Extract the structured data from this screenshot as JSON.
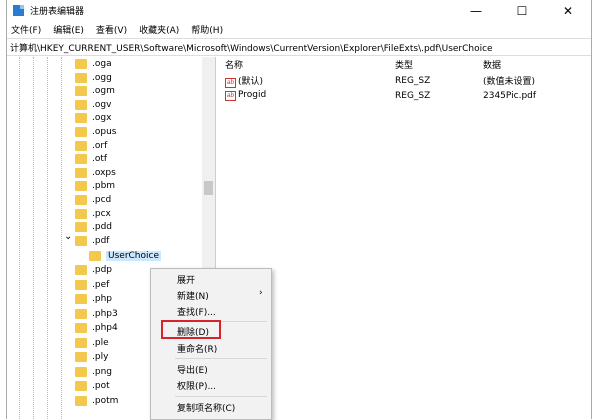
{
  "window": {
    "title": "注册表编辑器",
    "min": "—",
    "max": "☐",
    "close": "✕"
  },
  "menu": [
    "文件(F)",
    "编辑(E)",
    "查看(V)",
    "收藏夹(A)",
    "帮助(H)"
  ],
  "address": "计算机\\HKEY_CURRENT_USER\\Software\\Microsoft\\Windows\\CurrentVersion\\Explorer\\FileExts\\.pdf\\UserChoice",
  "tree": {
    "before": [
      ".oga",
      ".ogg",
      ".ogm",
      ".ogv",
      ".ogx",
      ".opus",
      ".orf",
      ".otf",
      ".oxps",
      ".pbm",
      ".pcd",
      ".pcx",
      ".pdd",
      ".pdf"
    ],
    "selected": "UserChoice",
    "after": [
      ".pdp",
      ".pef",
      ".php",
      ".php3",
      ".php4",
      ".ple",
      ".ply",
      ".png",
      ".pot",
      ".potm"
    ]
  },
  "values": {
    "headers": [
      "名称",
      "类型",
      "数据"
    ],
    "rows": [
      {
        "name": "(默认)",
        "type": "REG_SZ",
        "data": "(数值未设置)"
      },
      {
        "name": "Progid",
        "type": "REG_SZ",
        "data": "2345Pic.pdf"
      }
    ]
  },
  "context_menu": {
    "expand": "展开",
    "new": "新建(N)",
    "arrow": "›",
    "find": "查找(F)...",
    "delete": "删除(D)",
    "rename": "重命名(R)",
    "export": "导出(E)",
    "perm": "权限(P)...",
    "copy": "复制项名称(C)"
  },
  "highlight_color": "#d8232a"
}
